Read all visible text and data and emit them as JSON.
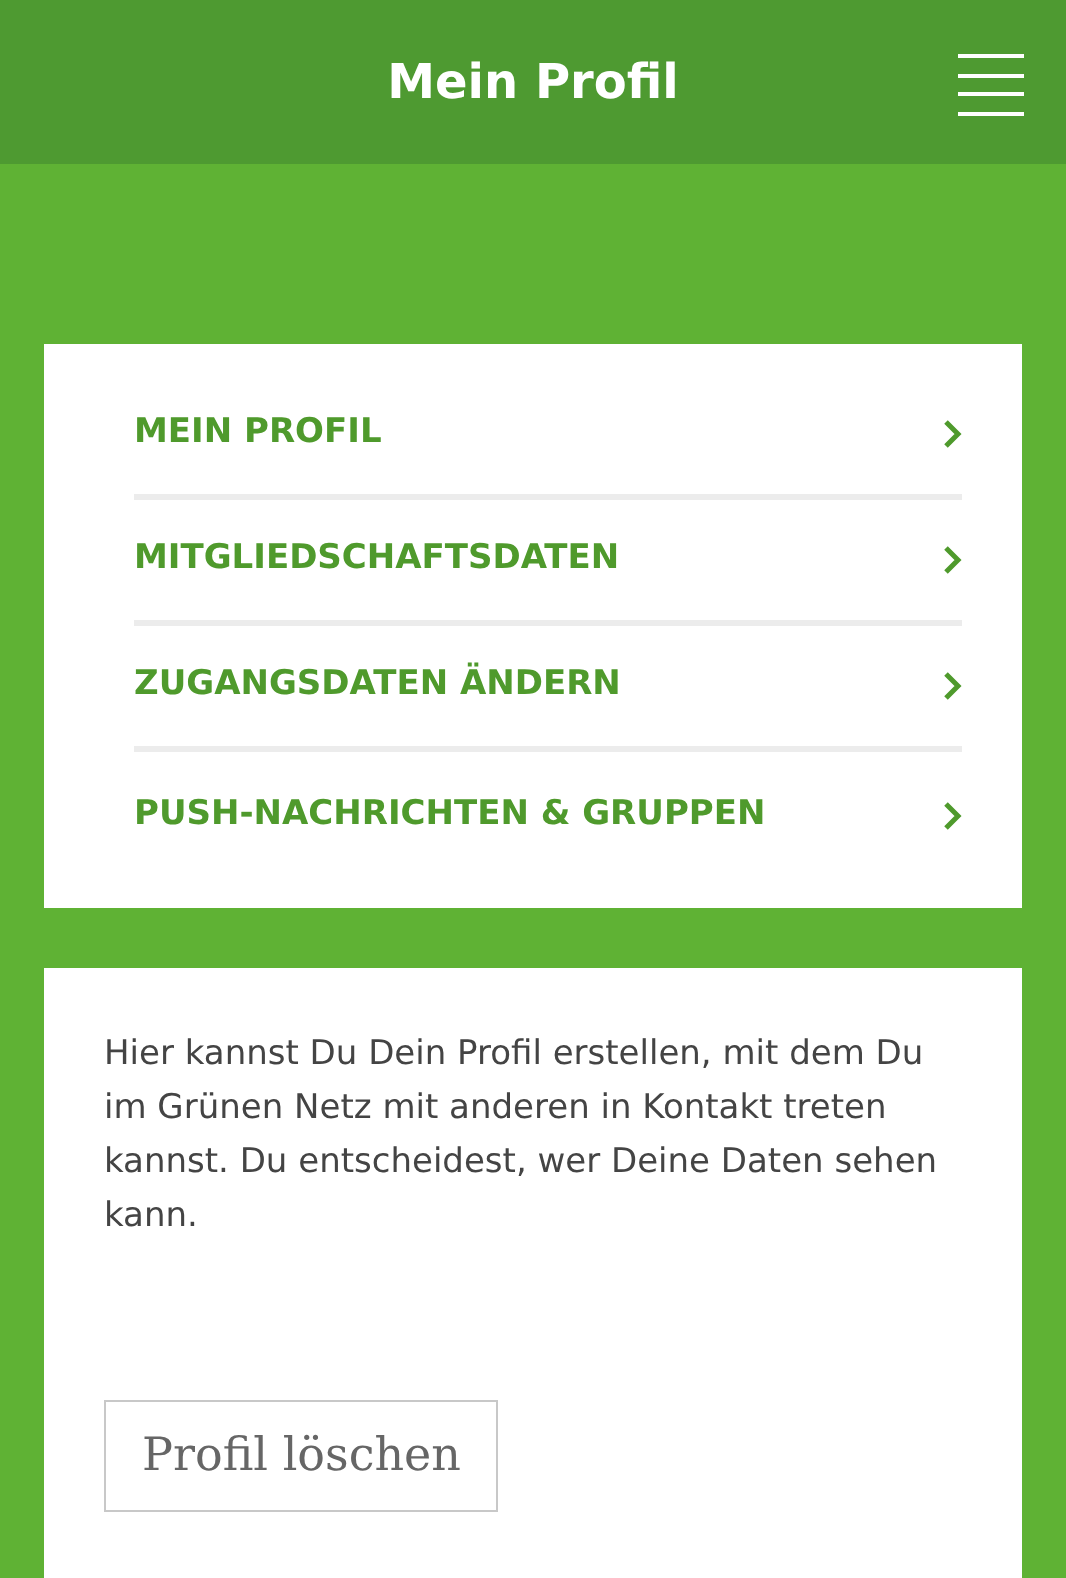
{
  "header": {
    "title": "Mein Profil"
  },
  "menu": [
    {
      "label": "MEIN PROFIL"
    },
    {
      "label": "MITGLIEDSCHAFTSDATEN"
    },
    {
      "label": "ZUGANGSDATEN ÄNDERN"
    },
    {
      "label": "PUSH-NACHRICHTEN & GRUPPEN"
    }
  ],
  "info": {
    "text": "Hier kannst Du Dein Profil erstellen, mit dem Du im Grünen Netz mit anderen in Kontakt treten kannst. Du entscheidest, wer Deine Daten sehen kann.",
    "button": "Profil löschen"
  }
}
